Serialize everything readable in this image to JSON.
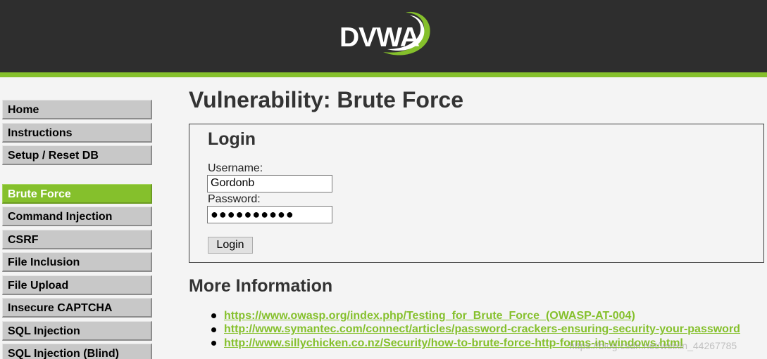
{
  "header": {
    "logo_text": "DVWA"
  },
  "colors": {
    "accent": "#85c02c",
    "header_bg": "#2e2e2e",
    "page_bg": "#f4f4f4"
  },
  "sidebar": {
    "groups": [
      [
        "Home",
        "Instructions",
        "Setup / Reset DB"
      ],
      [
        "Brute Force",
        "Command Injection",
        "CSRF",
        "File Inclusion",
        "File Upload",
        "Insecure CAPTCHA",
        "SQL Injection",
        "SQL Injection (Blind)"
      ]
    ],
    "selected": "Brute Force"
  },
  "main": {
    "title": "Vulnerability: Brute Force",
    "login": {
      "title": "Login",
      "username_label": "Username:",
      "username_value": "Gordonb",
      "password_label": "Password:",
      "password_value": "●●●●●●●●●●",
      "button_label": "Login"
    },
    "more_info": {
      "title": "More Information",
      "links": [
        "https://www.owasp.org/index.php/Testing_for_Brute_Force_(OWASP-AT-004)",
        "http://www.symantec.com/connect/articles/password-crackers-ensuring-security-your-password",
        "http://www.sillychicken.co.nz/Security/how-to-brute-force-http-forms-in-windows.html"
      ]
    }
  },
  "watermark": "https://blog.csdn.net/weixin_44267785"
}
